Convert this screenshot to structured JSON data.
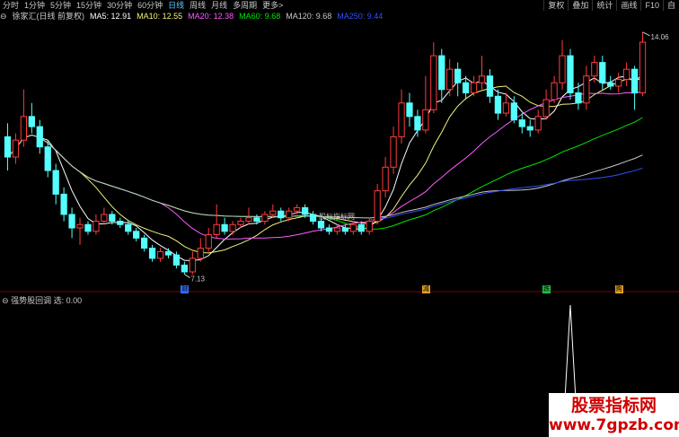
{
  "toolbar": {
    "periods": [
      "分时",
      "1分钟",
      "5分钟",
      "15分钟",
      "30分钟",
      "60分钟",
      "日线",
      "周线",
      "月线",
      "多周期",
      "更多>"
    ],
    "active_index": 6,
    "right_buttons": [
      "复权",
      "叠加",
      "统计",
      "画线",
      "F10",
      "自"
    ]
  },
  "ma_legend": {
    "title": "徐家汇(日线 前复权)",
    "items": [
      {
        "text": "MA5: 12.91",
        "color": "#ffffff"
      },
      {
        "text": "MA10: 12.55",
        "color": "#f2f27a"
      },
      {
        "text": "MA20: 12.38",
        "color": "#ff5cff"
      },
      {
        "text": "MA60: 9.68",
        "color": "#00e600"
      },
      {
        "text": "MA120: 9.68",
        "color": "#c8c8c8"
      },
      {
        "text": "MA250: 9.44",
        "color": "#3050ff"
      }
    ]
  },
  "annotations": {
    "high_label": "14.06",
    "low_label": "7.13",
    "center_label": "股标指标网"
  },
  "signals": [
    {
      "text": "财",
      "color": "#3070ff"
    },
    {
      "text": "减",
      "color": "#e0a020"
    },
    {
      "text": "跌",
      "color": "#20c040"
    },
    {
      "text": "购",
      "color": "#e0a020"
    }
  ],
  "sub_indicator": {
    "label": "强势股回调 选: 0.00"
  },
  "watermark": {
    "line1": "股票指标网",
    "line2": "www.7gpzb.com"
  },
  "colors": {
    "up": "#ff3c3c",
    "down": "#54ffff",
    "grid": "#800000"
  },
  "chart_data": {
    "type": "candlestick",
    "candles": [
      [
        11.2,
        10.6,
        11.6,
        10.2
      ],
      [
        10.6,
        11.1,
        11.3,
        10.4
      ],
      [
        11.1,
        11.8,
        12.6,
        10.9
      ],
      [
        11.8,
        11.5,
        12.2,
        11.3
      ],
      [
        11.5,
        10.9,
        11.7,
        10.7
      ],
      [
        10.9,
        10.2,
        11.1,
        10.0
      ],
      [
        10.2,
        9.5,
        10.4,
        9.2
      ],
      [
        9.5,
        8.9,
        9.7,
        8.7
      ],
      [
        8.9,
        8.5,
        9.1,
        8.2
      ],
      [
        8.5,
        8.6,
        8.8,
        8.0
      ],
      [
        8.6,
        8.4,
        8.7,
        8.3
      ],
      [
        8.4,
        8.7,
        8.9,
        8.3
      ],
      [
        8.7,
        8.9,
        9.1,
        8.6
      ],
      [
        8.9,
        8.7,
        9.0,
        8.6
      ],
      [
        8.7,
        8.6,
        8.8,
        8.5
      ],
      [
        8.6,
        8.4,
        8.7,
        8.3
      ],
      [
        8.4,
        8.2,
        8.5,
        8.1
      ],
      [
        8.2,
        7.9,
        8.3,
        7.8
      ],
      [
        7.9,
        7.6,
        8.0,
        7.5
      ],
      [
        7.6,
        7.8,
        7.9,
        7.5
      ],
      [
        7.8,
        7.7,
        7.9,
        7.6
      ],
      [
        7.7,
        7.4,
        7.8,
        7.3
      ],
      [
        7.4,
        7.2,
        7.5,
        7.13
      ],
      [
        7.2,
        7.6,
        7.8,
        7.13
      ],
      [
        7.6,
        7.9,
        8.2,
        7.5
      ],
      [
        7.9,
        8.3,
        8.5,
        7.8
      ],
      [
        8.3,
        8.6,
        9.2,
        8.2
      ],
      [
        8.6,
        8.4,
        8.8,
        8.3
      ],
      [
        8.4,
        8.6,
        8.7,
        8.3
      ],
      [
        8.6,
        8.7,
        8.8,
        8.5
      ],
      [
        8.7,
        8.8,
        9.1,
        8.6
      ],
      [
        8.8,
        8.7,
        8.9,
        8.6
      ],
      [
        8.7,
        8.9,
        9.0,
        8.6
      ],
      [
        8.9,
        9.0,
        9.2,
        8.8
      ],
      [
        9.0,
        8.8,
        9.1,
        8.7
      ],
      [
        8.8,
        9.0,
        9.1,
        8.7
      ],
      [
        9.0,
        9.1,
        9.2,
        8.9
      ],
      [
        9.1,
        8.9,
        9.2,
        8.8
      ],
      [
        8.9,
        8.7,
        9.0,
        8.6
      ],
      [
        8.7,
        8.5,
        8.8,
        8.4
      ],
      [
        8.5,
        8.4,
        8.6,
        8.3
      ],
      [
        8.4,
        8.5,
        8.6,
        8.3
      ],
      [
        8.5,
        8.4,
        8.6,
        8.3
      ],
      [
        8.4,
        8.6,
        8.7,
        8.3
      ],
      [
        8.6,
        8.4,
        8.7,
        8.3
      ],
      [
        8.4,
        8.7,
        8.8,
        8.3
      ],
      [
        8.7,
        9.6,
        9.8,
        8.6
      ],
      [
        9.6,
        10.3,
        10.6,
        9.4
      ],
      [
        10.3,
        11.2,
        11.5,
        10.1
      ],
      [
        11.2,
        12.2,
        12.6,
        11.0
      ],
      [
        12.2,
        11.8,
        12.5,
        11.5
      ],
      [
        11.8,
        11.4,
        12.0,
        11.2
      ],
      [
        11.4,
        12.0,
        13.0,
        11.3
      ],
      [
        12.0,
        13.6,
        14.0,
        11.9
      ],
      [
        13.6,
        12.6,
        13.8,
        12.2
      ],
      [
        12.6,
        13.2,
        13.5,
        12.4
      ],
      [
        13.2,
        12.8,
        13.4,
        12.4
      ],
      [
        12.8,
        12.5,
        13.0,
        12.3
      ],
      [
        12.5,
        12.8,
        13.0,
        12.4
      ],
      [
        12.8,
        13.0,
        13.6,
        12.6
      ],
      [
        13.0,
        12.4,
        13.2,
        12.2
      ],
      [
        12.4,
        11.9,
        12.6,
        11.7
      ],
      [
        11.9,
        12.2,
        12.5,
        11.8
      ],
      [
        12.2,
        11.7,
        12.4,
        11.6
      ],
      [
        11.7,
        11.5,
        11.9,
        11.3
      ],
      [
        11.5,
        11.4,
        11.7,
        11.2
      ],
      [
        11.4,
        11.8,
        12.0,
        11.3
      ],
      [
        11.8,
        12.3,
        12.6,
        11.7
      ],
      [
        12.3,
        12.8,
        13.0,
        12.2
      ],
      [
        12.8,
        13.6,
        14.06,
        12.6
      ],
      [
        13.6,
        12.5,
        13.8,
        12.3
      ],
      [
        12.5,
        12.2,
        12.8,
        12.0
      ],
      [
        12.2,
        13.0,
        13.3,
        12.0
      ],
      [
        13.0,
        13.4,
        13.6,
        12.8
      ],
      [
        13.4,
        12.8,
        13.6,
        12.6
      ],
      [
        12.8,
        12.7,
        13.0,
        12.6
      ],
      [
        12.7,
        12.9,
        13.1,
        12.5
      ],
      [
        12.9,
        13.2,
        13.4,
        12.7
      ],
      [
        13.2,
        12.5,
        13.3,
        12.0
      ],
      [
        12.5,
        14.0,
        14.3,
        12.4
      ]
    ],
    "y_range": [
      6.8,
      14.4
    ],
    "sub_series": {
      "name": "强势股回调 选",
      "values_spike_index": 70,
      "spike_value": 1.0
    }
  }
}
